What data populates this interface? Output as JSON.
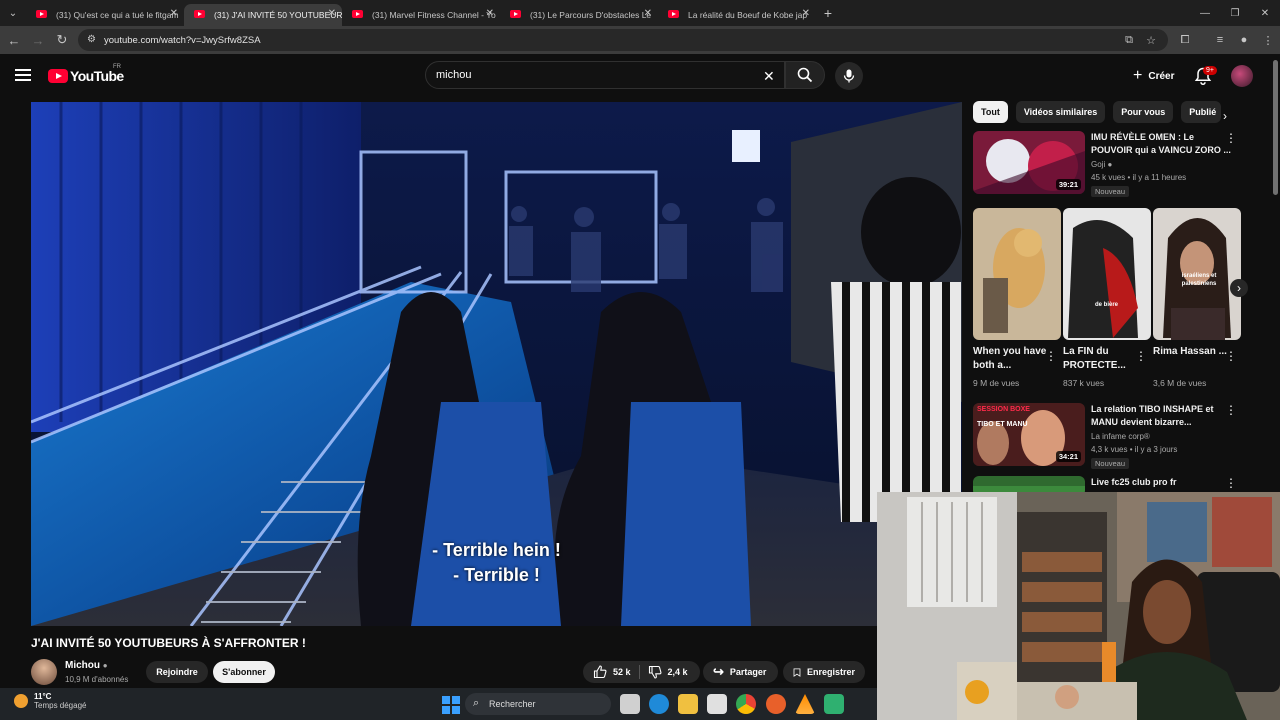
{
  "browser": {
    "tabs": [
      {
        "label": "(31) Qu'est ce qui a tué le fitgam",
        "active": false
      },
      {
        "label": "(31) J'AI INVITÉ 50 YOUTUBEURS",
        "active": true
      },
      {
        "label": "(31) Marvel Fitness Channel - Yo",
        "active": false
      },
      {
        "label": "(31) Le Parcours D'obstacles Le",
        "active": false
      },
      {
        "label": "La réalité du Boeuf de Kobe jap",
        "active": false
      }
    ],
    "url": "youtube.com/watch?v=JwySrfw8ZSA"
  },
  "youtube": {
    "logo_text": "YouTube",
    "country": "FR",
    "search_value": "michou",
    "create_label": "Créer",
    "notif_count": "9+"
  },
  "video": {
    "caption_line1": "- Terrible hein !",
    "caption_line2": "- Terrible !",
    "title": "J'AI INVITÉ 50 YOUTUBEURS À S'AFFRONTER !",
    "channel": "Michou",
    "subscribers": "10,9 M d'abonnés",
    "join_label": "Rejoindre",
    "subscribe_label": "S'abonner",
    "likes": "52 k",
    "dislikes": "2,4 k",
    "share_label": "Partager",
    "save_label": "Enregistrer"
  },
  "chips": [
    "Tout",
    "Vidéos similaires",
    "Pour vous",
    "Publié"
  ],
  "recs": [
    {
      "title": "IMU RÉVÈLE OMEN : Le POUVOIR qui a VAINCU ZORO ...",
      "channel": "Goji",
      "meta": "45 k vues • il y a 11 heures",
      "duration": "39:21",
      "tag": "Nouveau"
    },
    {
      "title": "La relation TIBO INSHAPE et MANU devient bizarre...",
      "channel": "La infame corp®",
      "meta": "4,3 k vues • il y a 3 jours",
      "duration": "34:21",
      "tag": "Nouveau"
    },
    {
      "title": "Live fc25 club pro fr",
      "channel": "",
      "meta": "",
      "duration": "",
      "tag": ""
    }
  ],
  "shorts": [
    {
      "title": "When you have both a...",
      "views": "9 M de vues"
    },
    {
      "title": "La FIN du PROTECTE...",
      "views": "837 k vues"
    },
    {
      "title": "Rima Hassan ...",
      "views": "3,6 M de vues"
    }
  ],
  "short_overlays": [
    "de bière",
    "israéliens et palestiniens"
  ],
  "thumb_overlays": [
    "SESSION BOXE",
    "TIBO ET MANU"
  ],
  "taskbar": {
    "temp": "11°C",
    "weather": "Temps dégagé",
    "search_placeholder": "Rechercher"
  }
}
